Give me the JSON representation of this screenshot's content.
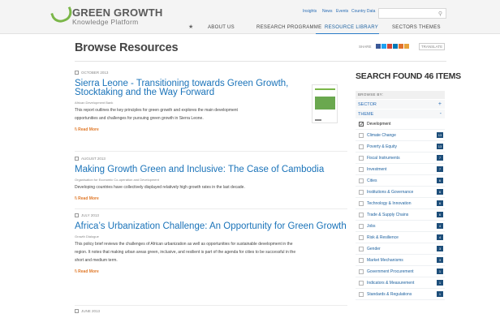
{
  "header": {
    "logo": {
      "line1": "GREEN GROWTH",
      "line2": "Knowledge Platform"
    },
    "utility_links": [
      "Insights",
      "News",
      "Events",
      "Country Data"
    ],
    "search": {
      "placeholder": ""
    },
    "nav": [
      "ABOUT US",
      "RESEARCH PROGRAMME",
      "RESOURCE LIBRARY",
      "SECTORS",
      "THEMES"
    ],
    "active_nav": "RESOURCE LIBRARY"
  },
  "page": {
    "title": "Browse Resources",
    "share_label": "SHARE",
    "translate_label": "TRANSLATE"
  },
  "articles": [
    {
      "date": "OCTOBER 2013",
      "title_line1": "Sierra Leone - Transitioning towards Green Growth,",
      "title_line2": "Stocktaking and the Way Forward",
      "org": "African Development Bank",
      "desc_line1": "This report outlines the key principles for green growth and explores the main development",
      "desc_line2": "opportunities and challenges for pursuing green growth in Sierra Leone.",
      "read_more": "\\\\ Read More"
    },
    {
      "date": "AUGUST 2013",
      "title_line1": "Making Growth Green and Inclusive: The Case of Cambodia",
      "org": "Organisation for Economic Co-operation and Development",
      "desc_line1": "Developing countries have collectively displayed relatively high growth rates in the last decade.",
      "read_more": "\\\\ Read More"
    },
    {
      "date": "JULY 2013",
      "title_line1": "Africa’s Urbanization Challenge: An Opportunity for Green Growth",
      "org": "Growth Dialogue",
      "desc_line1": "This policy brief reviews the challenges of African urbanization as well as opportunities for sustainable development in the",
      "desc_line2": "region. It notes that making urban areas green, inclusive, and resilient is part of the agenda for cities to be successful in the",
      "desc_line3": "short and medium term.",
      "read_more": "\\\\ Read More"
    },
    {
      "date": "JUNE 2013"
    }
  ],
  "sidebar": {
    "search_found": "SEARCH FOUND 46 ITEMS",
    "browse_by": "BROWSE BY:",
    "sector_label": "SECTOR",
    "sector_sign": "+",
    "theme_label": "THEME",
    "theme_sign": "-",
    "themes": [
      {
        "label": "Development",
        "count": "",
        "checked": true
      },
      {
        "label": "Climate Change",
        "count": "13"
      },
      {
        "label": "Poverty & Equity",
        "count": "13"
      },
      {
        "label": "Fiscal Instruments",
        "count": "7"
      },
      {
        "label": "Investment",
        "count": "7"
      },
      {
        "label": "Cities",
        "count": "6"
      },
      {
        "label": "Institutions & Governance",
        "count": "6"
      },
      {
        "label": "Technology & Innovation",
        "count": "6"
      },
      {
        "label": "Trade & Supply Chains",
        "count": "6"
      },
      {
        "label": "Jobs",
        "count": "4"
      },
      {
        "label": "Risk & Resilience",
        "count": "4"
      },
      {
        "label": "Gender",
        "count": "3"
      },
      {
        "label": "Market Mechanisms",
        "count": "3"
      },
      {
        "label": "Government Procurement",
        "count": "1"
      },
      {
        "label": "Indicators & Measurement",
        "count": "1"
      },
      {
        "label": "Standards & Regulations",
        "count": "1"
      }
    ]
  },
  "colors": {
    "brand_green": "#7ab648",
    "link_blue": "#1a73b9",
    "read_more_orange": "#e07a2b",
    "count_badge": "#1d4e7a"
  }
}
